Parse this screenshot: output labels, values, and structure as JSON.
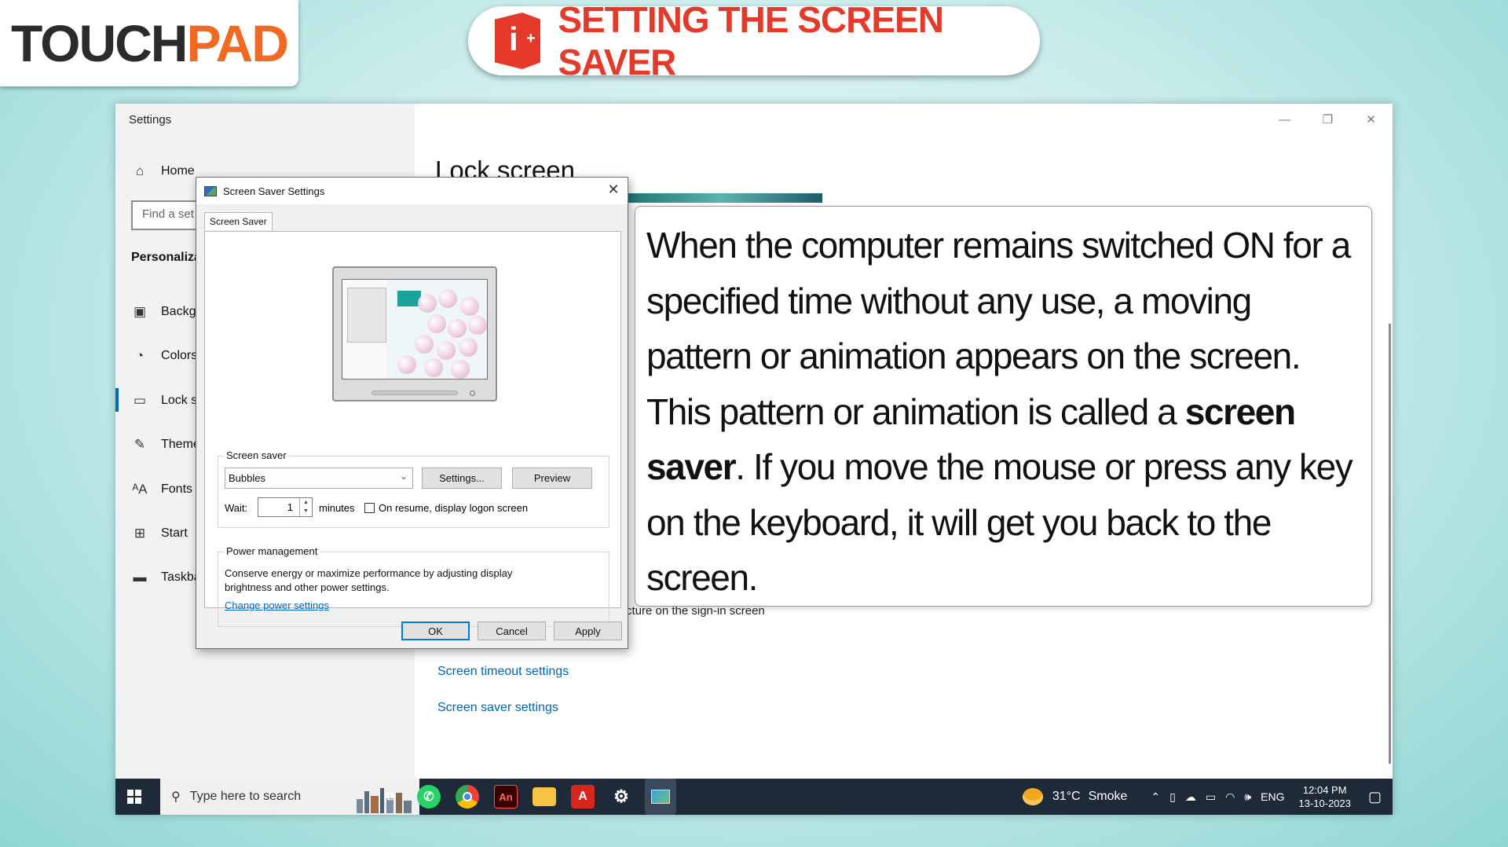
{
  "brand": {
    "logo_touch": "TOUCH",
    "logo_pad": "PAD"
  },
  "title": {
    "icon_text": "i",
    "icon_plus": "+",
    "text": "SETTING THE SCREEN SAVER"
  },
  "settings": {
    "window_title": "Settings",
    "home": "Home",
    "find_placeholder": "Find a set",
    "section": "Personaliza",
    "nav": [
      {
        "label": "Backgr",
        "icon": "image-icon"
      },
      {
        "label": "Colors",
        "icon": "palette-icon"
      },
      {
        "label": "Lock s",
        "icon": "lock-screen-icon"
      },
      {
        "label": "Theme",
        "icon": "theme-icon"
      },
      {
        "label": "Fonts",
        "icon": "fonts-icon"
      },
      {
        "label": "Start",
        "icon": "start-icon"
      },
      {
        "label": "Taskba",
        "icon": "taskbar-icon"
      }
    ],
    "heading": "Lock screen",
    "signin_text": "cture on the sign-in screen",
    "timeout_link": "Screen timeout settings",
    "saver_link": "Screen saver settings"
  },
  "dialog": {
    "title": "Screen Saver Settings",
    "tab": "Screen Saver",
    "group_label": "Screen saver",
    "selected": "Bubbles",
    "settings_button": "Settings...",
    "preview_button": "Preview",
    "wait_label": "Wait:",
    "wait_value": "1",
    "minutes_label": "minutes",
    "resume_label": "On resume, display logon screen",
    "resume_checked": false,
    "power_label": "Power management",
    "power_desc": "Conserve energy or maximize performance by adjusting display brightness and other power settings.",
    "power_link": "Change power settings",
    "ok": "OK",
    "cancel": "Cancel",
    "apply": "Apply"
  },
  "callout": {
    "part1": "When the computer remains switched ON for a specified time without any use, a moving pattern or animation appears on the screen. This pattern or animation is called a ",
    "bold1": "screen saver",
    "part2": ". If you move the mouse or press any key on the keyboard, it will get you back to the screen."
  },
  "taskbar": {
    "search_placeholder": "Type here to search",
    "weather_temp": "31°C",
    "weather_desc": "Smoke",
    "lang": "ENG",
    "time": "12:04 PM",
    "date": "13-10-2023",
    "apps": [
      "task-view-icon",
      "whatsapp-icon",
      "chrome-icon",
      "animate-icon",
      "file-explorer-icon",
      "acrobat-icon",
      "settings-icon",
      "control-panel-icon"
    ]
  },
  "colors": {
    "accent": "#f26a21",
    "title_red": "#e5392a",
    "link_blue": "#0063b1",
    "taskbar": "#1e2a38"
  }
}
